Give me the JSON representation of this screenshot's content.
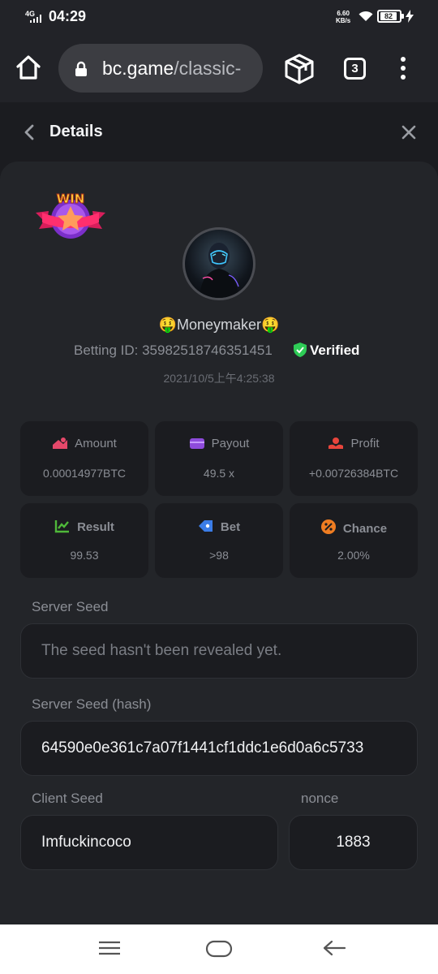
{
  "status_bar": {
    "network": "4G",
    "time": "04:29",
    "speed_value": "6.60",
    "speed_unit": "KB/s",
    "battery": "82"
  },
  "browser": {
    "url_host": "bc.game",
    "url_path": "/classic-",
    "tab_count": "3"
  },
  "header": {
    "title": "Details"
  },
  "profile": {
    "username": "🤑Moneymaker🤑",
    "betting_id": "Betting ID: 35982518746351451",
    "verified": "Verified",
    "datetime": "2021/10/5上午4:25:38",
    "badge": "WIN"
  },
  "stats": {
    "amount": {
      "label": "Amount",
      "value": "0.00014977BTC"
    },
    "payout": {
      "label": "Payout",
      "value": "49.5 x"
    },
    "profit": {
      "label": "Profit",
      "value": "+0.00726384BTC"
    },
    "result": {
      "label": "Result",
      "value": "99.53"
    },
    "bet": {
      "label": "Bet",
      "value": ">98"
    },
    "chance": {
      "label": "Chance",
      "value": "2.00%"
    }
  },
  "server_seed": {
    "label": "Server Seed",
    "value": "The seed hasn't been revealed yet."
  },
  "server_seed_hash": {
    "label": "Server Seed (hash)",
    "value": "64590e0e361c7a07f1441cf1ddc1e6d0a6c5733"
  },
  "client_seed": {
    "label": "Client Seed",
    "value": "Imfuckincoco"
  },
  "nonce": {
    "label": "nonce",
    "value": "1883"
  },
  "colors": {
    "background": "#1b1c20",
    "card": "#232529",
    "verified_green": "#2ecc56",
    "amount_icon": "#e5486a",
    "payout_icon": "#8e4bdc",
    "profit_icon": "#e8453c",
    "result_icon": "#4fb83a",
    "bet_icon": "#3b7de8",
    "chance_icon": "#ef7d22"
  }
}
